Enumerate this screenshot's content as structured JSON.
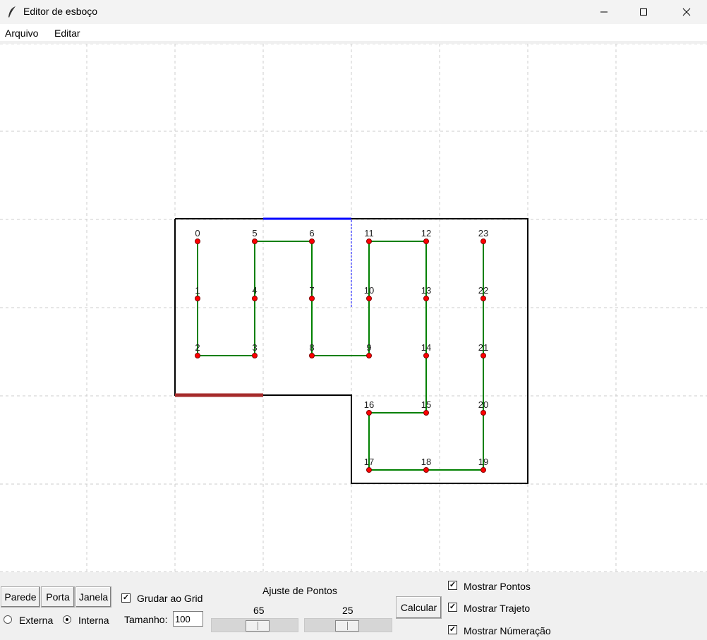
{
  "window": {
    "title": "Editor de esboço",
    "icon": "feather-icon"
  },
  "menu": {
    "items": [
      "Arquivo",
      "Editar"
    ]
  },
  "sketch": {
    "points": [
      {
        "n": "0"
      },
      {
        "n": "1"
      },
      {
        "n": "2"
      },
      {
        "n": "3"
      },
      {
        "n": "4"
      },
      {
        "n": "5"
      },
      {
        "n": "6"
      },
      {
        "n": "7"
      },
      {
        "n": "8"
      },
      {
        "n": "9"
      },
      {
        "n": "10"
      },
      {
        "n": "11"
      },
      {
        "n": "12"
      },
      {
        "n": "13"
      },
      {
        "n": "14"
      },
      {
        "n": "15"
      },
      {
        "n": "16"
      },
      {
        "n": "17"
      },
      {
        "n": "18"
      },
      {
        "n": "19"
      },
      {
        "n": "20"
      },
      {
        "n": "21"
      },
      {
        "n": "22"
      },
      {
        "n": "23"
      }
    ],
    "colors": {
      "wall": "#000000",
      "door": "#a52a2a",
      "window": "#0000ff",
      "path": "#008000",
      "point": "#ff0000",
      "grid": "#cccccc"
    }
  },
  "toolbar": {
    "parede": "Parede",
    "porta": "Porta",
    "janela": "Janela",
    "externa": "Externa",
    "interna": "Interna",
    "selected_side": "Interna",
    "grudar": "Grudar ao Grid",
    "grudar_checked": true,
    "tamanho_label": "Tamanho:",
    "tamanho_value": "100",
    "ajuste_label": "Ajuste de Pontos",
    "slider1_value": "65",
    "slider2_value": "25",
    "calcular": "Calcular",
    "mostrar_pontos": "Mostrar Pontos",
    "mostrar_trajeto": "Mostrar Trajeto",
    "mostrar_numeracao": "Mostrar Númeração",
    "pontos_checked": true,
    "trajeto_checked": true,
    "numeracao_checked": true
  }
}
